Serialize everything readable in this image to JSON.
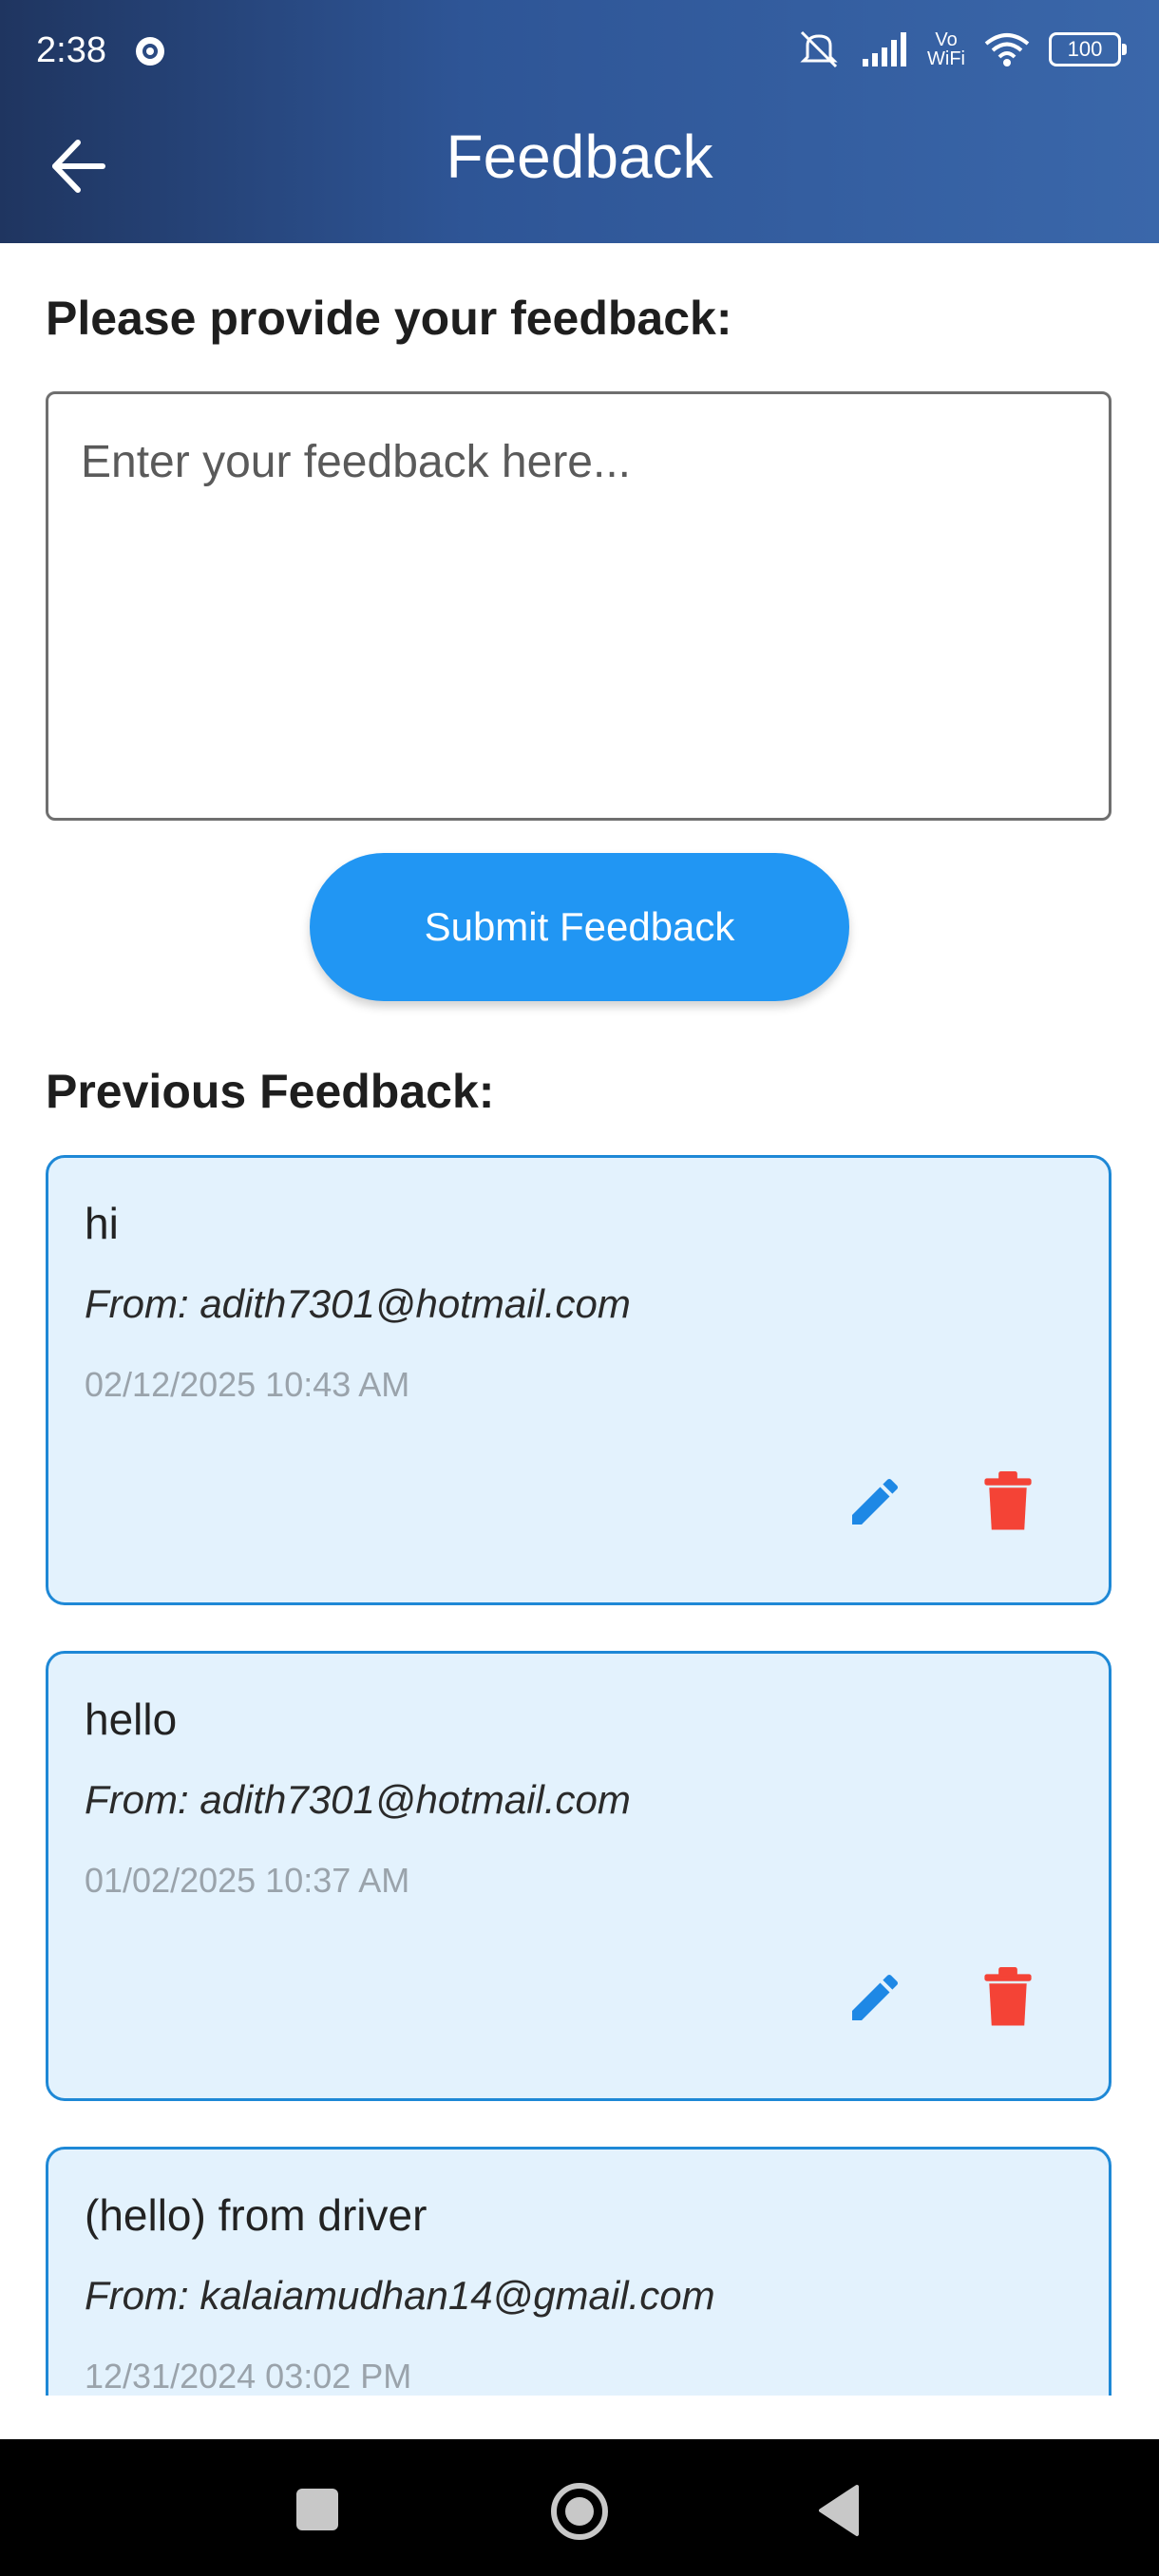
{
  "status_bar": {
    "time": "2:38",
    "battery": "100",
    "wifi_label_top": "Vo",
    "wifi_label_bottom": "WiFi"
  },
  "app_bar": {
    "title": "Feedback"
  },
  "form": {
    "prompt": "Please provide your feedback:",
    "placeholder": "Enter your feedback here...",
    "submit_label": "Submit Feedback"
  },
  "previous": {
    "heading": "Previous Feedback:",
    "items": [
      {
        "message": "hi",
        "from": "From: adith7301@hotmail.com",
        "date": "02/12/2025 10:43 AM"
      },
      {
        "message": "hello",
        "from": "From: adith7301@hotmail.com",
        "date": "01/02/2025 10:37 AM"
      },
      {
        "message": "(hello) from driver",
        "from": "From: kalaiamudhan14@gmail.com",
        "date": "12/31/2024 03:02 PM"
      }
    ]
  },
  "colors": {
    "accent": "#2196f3",
    "card_bg": "#e3f2fd",
    "card_border": "#1e88d6",
    "delete": "#f44336",
    "edit": "#1e88e5"
  },
  "icons": [
    "back-arrow-icon",
    "edit-icon",
    "delete-icon",
    "square-icon",
    "home-icon",
    "back-triangle-icon"
  ]
}
